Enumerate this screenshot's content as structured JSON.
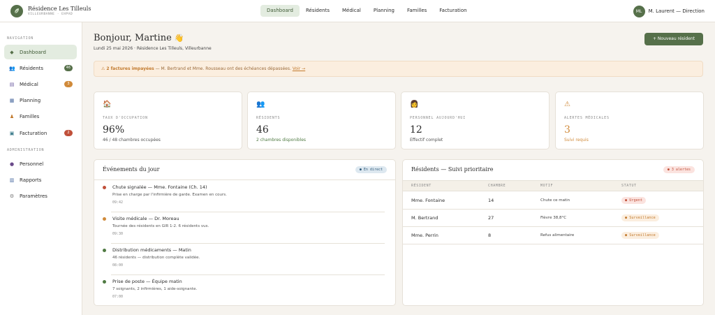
{
  "brand": {
    "name": "Résidence Les Tilleuls",
    "subtitle": "VILLEURBANNE · EHPAD"
  },
  "topnav": [
    "Dashboard",
    "Résidents",
    "Médical",
    "Planning",
    "Familles",
    "Facturation"
  ],
  "user": {
    "initials": "ML",
    "name": "M. Laurent — Direction"
  },
  "sidebar": {
    "nav_label": "NAVIGATION",
    "admin_label": "ADMINISTRATION",
    "items": [
      {
        "label": "Dashboard",
        "icon": "diamond-icon"
      },
      {
        "label": "Résidents",
        "icon": "people-icon",
        "badge": "46"
      },
      {
        "label": "Médical",
        "icon": "clipboard-icon",
        "badge": "3"
      },
      {
        "label": "Planning",
        "icon": "calendar-icon"
      },
      {
        "label": "Familles",
        "icon": "family-icon"
      },
      {
        "label": "Facturation",
        "icon": "invoice-icon",
        "badge": "2"
      }
    ],
    "admin_items": [
      {
        "label": "Personnel",
        "icon": "person-icon"
      },
      {
        "label": "Rapports",
        "icon": "chart-icon"
      },
      {
        "label": "Paramètres",
        "icon": "gear-icon"
      }
    ]
  },
  "header": {
    "greeting": "Bonjour, Martine",
    "greeting_emoji": "👋",
    "subtitle": "Lundi 25 mai 2026 · Résidence Les Tilleuls, Villeurbanne",
    "new_button": "+ Nouveau résident"
  },
  "alert": {
    "icon": "⚠",
    "strong": "2 factures impayées",
    "text": " — M. Bertrand et Mme. Rousseau ont des échéances dépassées. ",
    "link": "Voir →"
  },
  "stats": [
    {
      "icon": "house-icon",
      "label": "TAUX D'OCCUPATION",
      "value": "96%",
      "sub": "46 / 48 chambres occupées"
    },
    {
      "icon": "people-icon",
      "label": "RÉSIDENTS",
      "value": "46",
      "sub": "2 chambres disponibles"
    },
    {
      "icon": "staff-icon",
      "label": "PERSONNEL AUJOURD'HUI",
      "value": "12",
      "sub": "Effectif complet"
    },
    {
      "icon": "warning-icon",
      "label": "ALERTES MÉDICALES",
      "value": "3",
      "sub": "Suivi requis"
    }
  ],
  "events": {
    "title": "Événements du jour",
    "badge": "● En direct",
    "items": [
      {
        "title": "Chute signalée — Mme. Fontaine (Ch. 14)",
        "desc": "Prise en charge par l'infirmière de garde. Examen en cours.",
        "time": "09:42",
        "color": "#c0503a"
      },
      {
        "title": "Visite médicale — Dr. Moreau",
        "desc": "Tournée des résidents en GIR 1-2. 6 résidents vus.",
        "time": "09:30",
        "color": "#d08a3a"
      },
      {
        "title": "Distribution médicaments — Matin",
        "desc": "46 résidents — distribution complète validée.",
        "time": "08:00",
        "color": "#4f7a42"
      },
      {
        "title": "Prise de poste — Équipe matin",
        "desc": "7 soignants, 2 infirmières, 1 aide-soignante.",
        "time": "07:00",
        "color": "#4f7a42"
      }
    ]
  },
  "residents": {
    "title": "Résidents — Suivi prioritaire",
    "badge": "● 3 alertes",
    "columns": [
      "RÉSIDENT",
      "CHAMBRE",
      "MOTIF",
      "STATUT"
    ],
    "rows": [
      {
        "name": "Mme. Fontaine",
        "room": "14",
        "reason": "Chute ce matin",
        "status": "● Urgent"
      },
      {
        "name": "M. Bertrand",
        "room": "27",
        "reason": "Fièvre 38,8°C",
        "status": "● Surveillance"
      },
      {
        "name": "Mme. Perrin",
        "room": "8",
        "reason": "Refus alimentaire",
        "status": "● Surveillance"
      }
    ]
  },
  "colors": {
    "accent": "#56704a",
    "accent_light": "#e3ece0",
    "alert_bg": "#fbeedf",
    "danger": "#c0503a",
    "warning": "#d08a3a"
  }
}
